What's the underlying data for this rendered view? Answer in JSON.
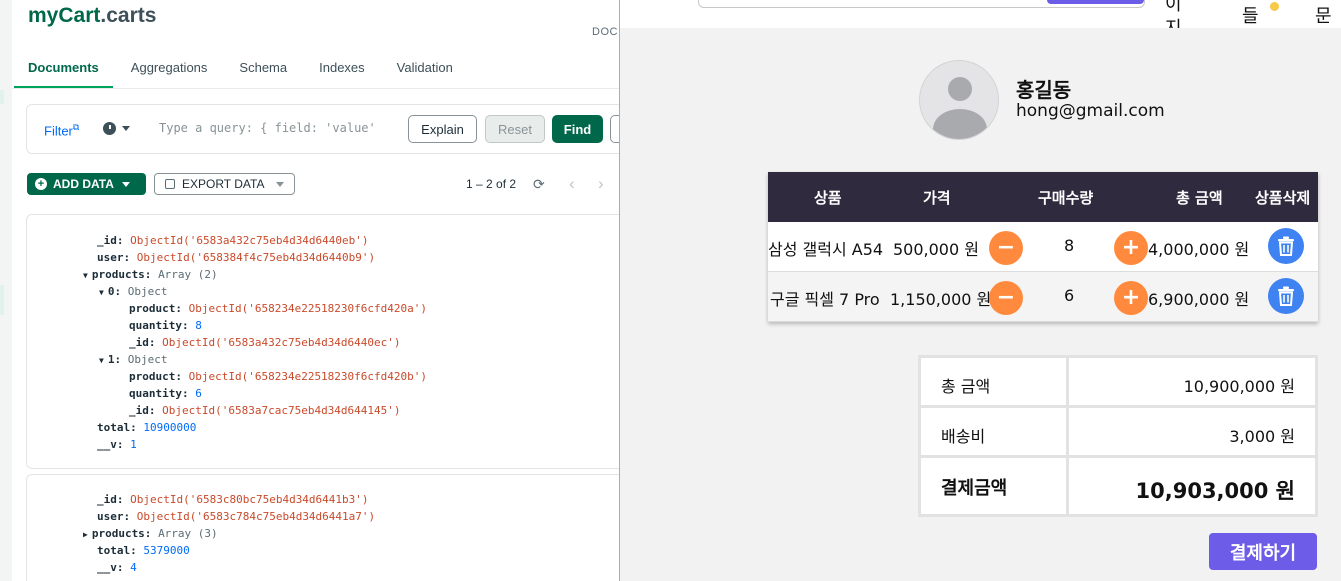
{
  "compass": {
    "collection_db": "myCart",
    "collection_name": ".carts",
    "docs_label": "DOC",
    "tabs": [
      "Documents",
      "Aggregations",
      "Schema",
      "Indexes",
      "Validation"
    ],
    "filter": {
      "label": "Filter",
      "query_placeholder": "Type a query: { field: 'value'",
      "explain": "Explain",
      "reset": "Reset",
      "find": "Find"
    },
    "add_data": "ADD DATA",
    "export_data": "EXPORT DATA",
    "pager": "1 – 2 of 2",
    "doc1": {
      "id_key": "_id:",
      "id_val": "ObjectId('6583a432c75eb4d34d6440eb')",
      "user_key": "user:",
      "user_val": "ObjectId('658384f4c75eb4d34d6440b9')",
      "products_key": "products:",
      "products_val": "Array (2)",
      "item0_key": "0:",
      "item0_val": "Object",
      "item0_product_key": "product:",
      "item0_product_val": "ObjectId('658234e22518230f6cfd420a')",
      "item0_qty_key": "quantity:",
      "item0_qty_val": "8",
      "item0_id_key": "_id:",
      "item0_id_val": "ObjectId('6583a432c75eb4d34d6440ec')",
      "item1_key": "1:",
      "item1_val": "Object",
      "item1_product_key": "product:",
      "item1_product_val": "ObjectId('658234e22518230f6cfd420b')",
      "item1_qty_key": "quantity:",
      "item1_qty_val": "6",
      "item1_id_key": "_id:",
      "item1_id_val": "ObjectId('6583a7cac75eb4d34d644145')",
      "total_key": "total:",
      "total_val": "10900000",
      "v_key": "__v:",
      "v_val": "1"
    },
    "doc2": {
      "id_key": "_id:",
      "id_val": "ObjectId('6583c80bc75eb4d34d6441b3')",
      "user_key": "user:",
      "user_val": "ObjectId('6583c784c75eb4d34d6441a7')",
      "products_key": "products:",
      "products_val": "Array (3)",
      "total_key": "total:",
      "total_val": "5379000",
      "v_key": "__v:",
      "v_val": "4"
    }
  },
  "cart_app": {
    "nav_fragments": [
      "이",
      "지",
      "들",
      "문"
    ],
    "user": {
      "name": "홍길동",
      "email": "hong@gmail.com"
    },
    "table_headers": [
      "상품",
      "가격",
      "구매수량",
      "총 금액",
      "상품삭제"
    ],
    "rows": [
      {
        "product": "삼성 갤럭시 A54",
        "price": "500,000 원",
        "qty": "8",
        "total": "4,000,000 원"
      },
      {
        "product": "구글 픽셀 7 Pro",
        "price": "1,150,000 원",
        "qty": "6",
        "total": "6,900,000 원"
      }
    ],
    "minus": "−",
    "plus": "+",
    "summary": [
      {
        "label": "총 금액",
        "value": "10,900,000 원"
      },
      {
        "label": "배송비",
        "value": "3,000 원"
      },
      {
        "label": "결제금액",
        "value": "10,903,000 원"
      }
    ],
    "pay_button": "결제하기",
    "colors": {
      "accent": "#6c5ce7",
      "orange": "#ff8a3d",
      "blue": "#3f82f2",
      "header": "#2f2a3e",
      "compass_green": "#00684a"
    }
  }
}
